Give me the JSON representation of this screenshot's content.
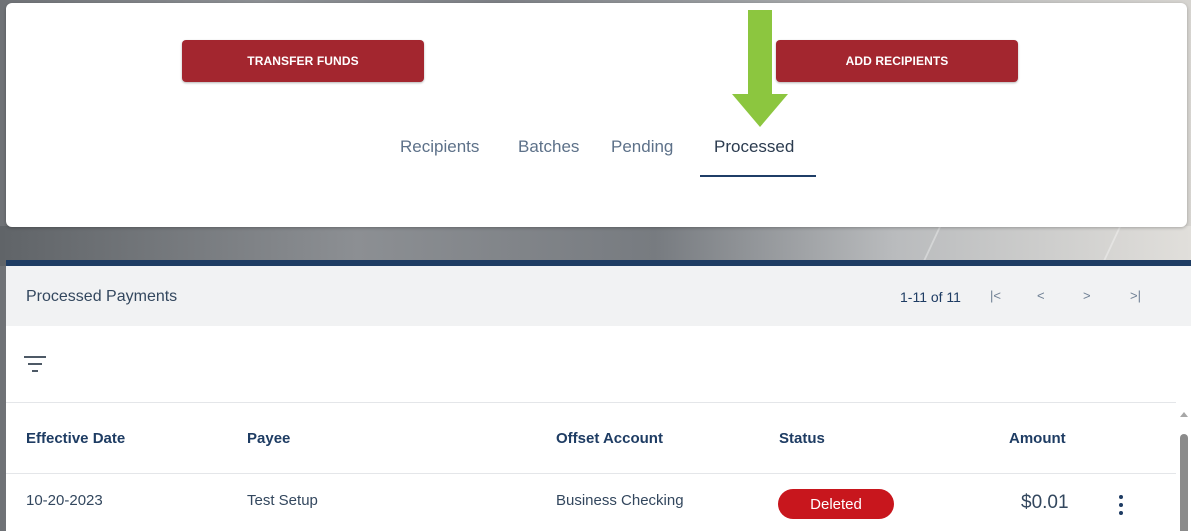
{
  "actions": {
    "transfer_label": "TRANSFER FUNDS",
    "add_label": "ADD RECIPIENTS"
  },
  "tabs": [
    {
      "label": "Recipients",
      "active": false
    },
    {
      "label": "Batches",
      "active": false
    },
    {
      "label": "Pending",
      "active": false
    },
    {
      "label": "Processed",
      "active": true
    }
  ],
  "panel": {
    "title": "Processed Payments",
    "page_info": "1-11 of 11",
    "pager": {
      "first": "|<",
      "prev": "<",
      "next": ">",
      "last": ">|"
    }
  },
  "table": {
    "columns": [
      "Effective Date",
      "Payee",
      "Offset Account",
      "Status",
      "Amount"
    ],
    "rows": [
      {
        "effective_date": "10-20-2023",
        "payee": "Test Setup",
        "offset_account": "Business Checking",
        "status": "Deleted",
        "amount": "$0.01"
      }
    ]
  },
  "colors": {
    "brand_red": "#a3262f",
    "navy": "#1e3c63",
    "status_deleted": "#c8161d",
    "annotation_arrow": "#8cc63f"
  },
  "icons": {
    "filter": "filter-icon",
    "row_menu": "kebab-menu-icon",
    "annotation": "arrow-down-icon"
  }
}
